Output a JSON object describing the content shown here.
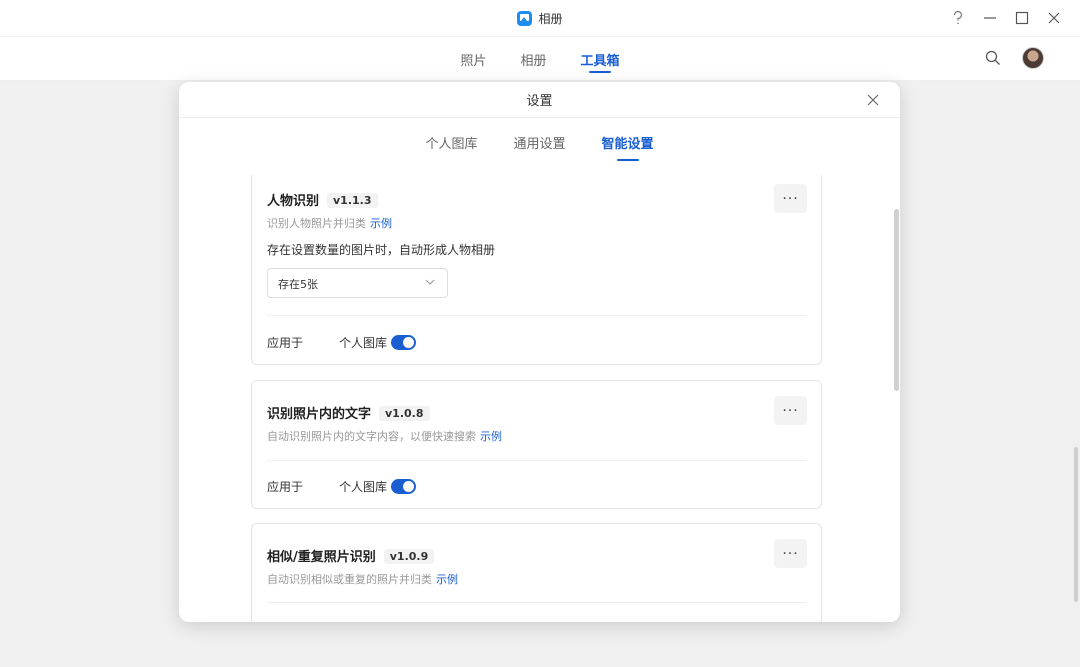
{
  "window": {
    "title": "相册",
    "help_icon": "help-icon",
    "controls": [
      "minimize-icon",
      "maximize-icon",
      "close-icon"
    ]
  },
  "nav": {
    "tabs": [
      {
        "label": "照片",
        "active": false
      },
      {
        "label": "相册",
        "active": false
      },
      {
        "label": "工具箱",
        "active": true
      }
    ]
  },
  "dialog": {
    "title": "设置",
    "tabs": [
      {
        "label": "个人图库",
        "active": false
      },
      {
        "label": "通用设置",
        "active": false
      },
      {
        "label": "智能设置",
        "active": true
      }
    ],
    "cards": [
      {
        "title": "人物识别",
        "version": "v1.1.3",
        "desc": "识别人物照片并归类",
        "link": "示例",
        "option_label": "存在设置数量的图片时，自动形成人物相册",
        "select_value": "存在5张",
        "apply_label": "应用于",
        "library": "个人图库",
        "enabled": true
      },
      {
        "title": "识别照片内的文字",
        "version": "v1.0.8",
        "desc": "自动识别照片内的文字内容，以便快速搜索",
        "link": "示例",
        "apply_label": "应用于",
        "library": "个人图库",
        "enabled": true
      },
      {
        "title": "相似/重复照片识别",
        "version": "v1.0.9",
        "desc": "自动识别相似或重复的照片并归类",
        "link": "示例"
      }
    ]
  },
  "colors": {
    "accent": "#1a5fd1",
    "app_icon": "#1f8cf0"
  }
}
